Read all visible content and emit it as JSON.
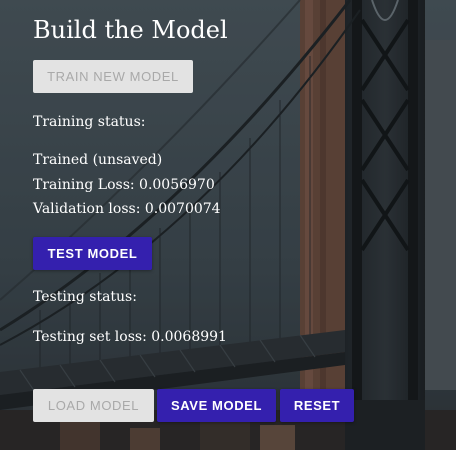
{
  "header": {
    "title": "Build the Model"
  },
  "training": {
    "train_button_label": "TRAIN NEW MODEL",
    "status_label": "Training status:",
    "status_value": "Trained (unsaved)",
    "training_loss": "Training Loss: 0.0056970",
    "validation_loss": "Validation loss: 0.0070074"
  },
  "testing": {
    "test_button_label": "TEST MODEL",
    "status_label": "Testing status:",
    "testing_loss": "Testing set loss: 0.0068991"
  },
  "actions": {
    "load_label": "LOAD MODEL",
    "save_label": "SAVE MODEL",
    "reset_label": "RESET"
  },
  "colors": {
    "accent": "#3420ae",
    "disabled_bg": "#e3e3e3",
    "disabled_text": "#a9a9a9"
  }
}
